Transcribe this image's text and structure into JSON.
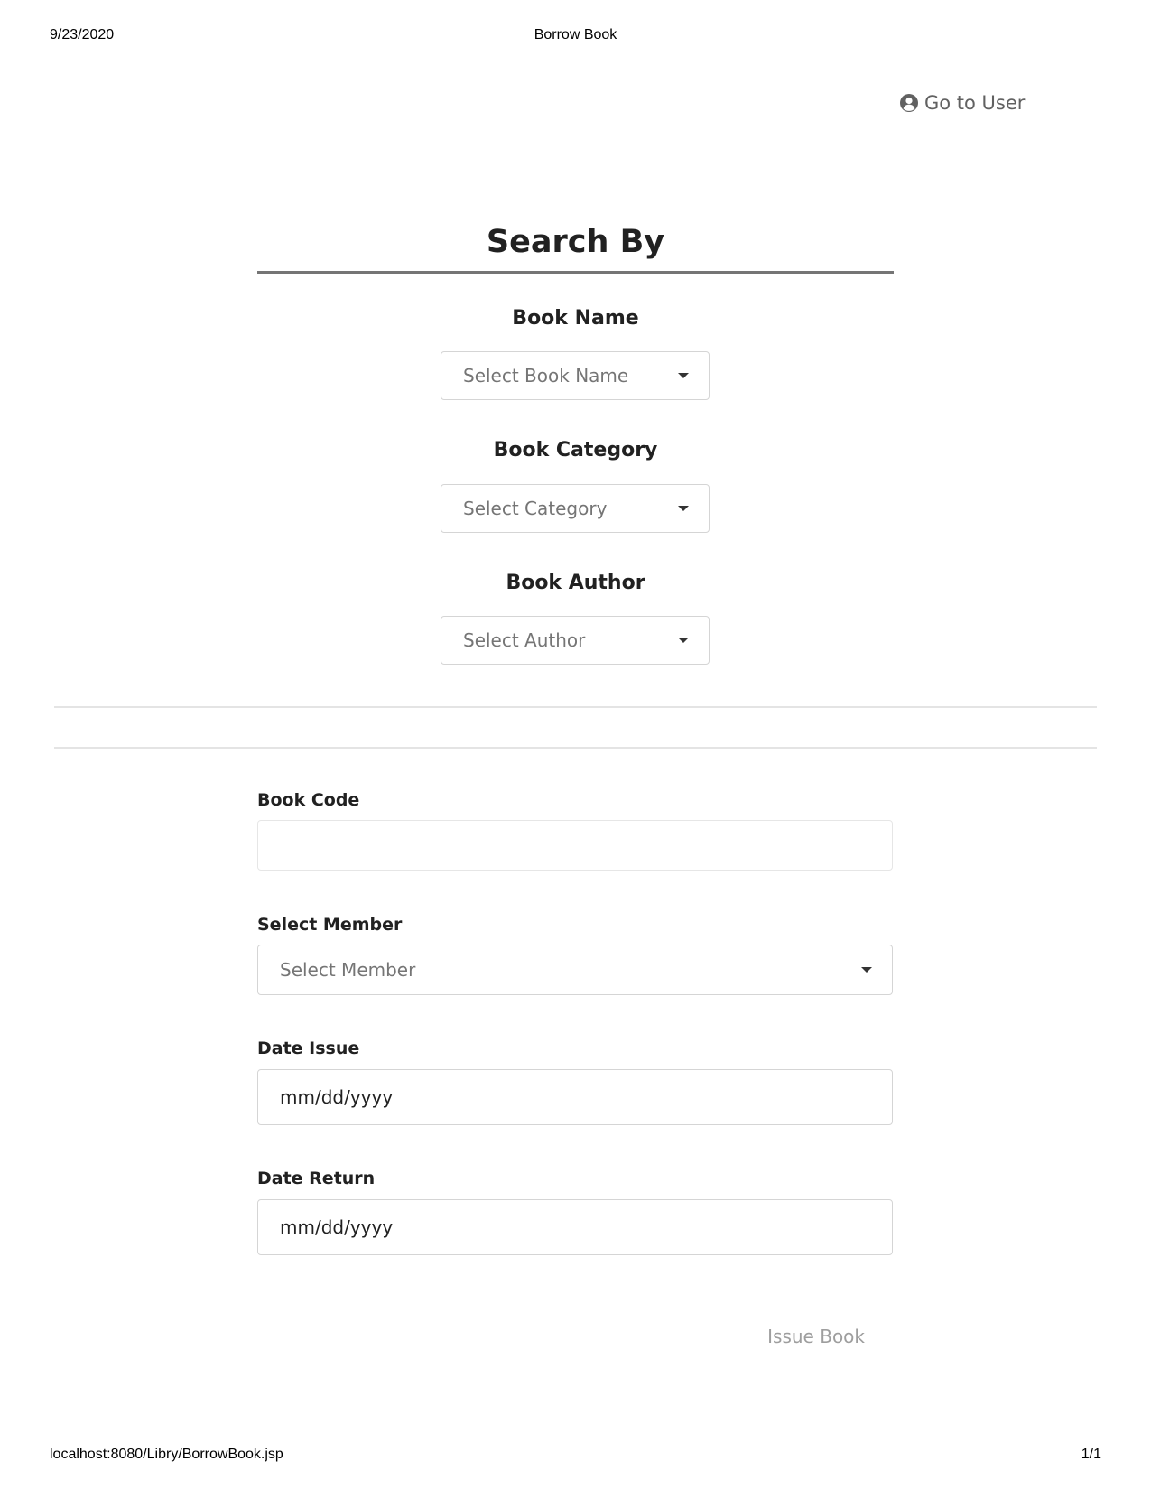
{
  "print_header": {
    "date": "9/23/2020",
    "title": "Borrow Book"
  },
  "print_footer": {
    "url": "localhost:8080/Libry/BorrowBook.jsp",
    "page": "1/1"
  },
  "nav": {
    "go_to_user_label": "Go to User",
    "icon": "user-circle-icon"
  },
  "search": {
    "heading": "Search By",
    "book_name": {
      "label": "Book Name",
      "selected": "Select Book Name"
    },
    "book_category": {
      "label": "Book Category",
      "selected": "Select Category"
    },
    "book_author": {
      "label": "Book Author",
      "selected": "Select Author"
    }
  },
  "form": {
    "book_code": {
      "label": "Book Code",
      "value": ""
    },
    "member": {
      "label": "Select Member",
      "selected": "Select Member"
    },
    "date_issue": {
      "label": "Date Issue",
      "value": "mm/dd/yyyy"
    },
    "date_return": {
      "label": "Date Return",
      "value": "mm/dd/yyyy"
    },
    "submit_label": "Issue Book"
  }
}
